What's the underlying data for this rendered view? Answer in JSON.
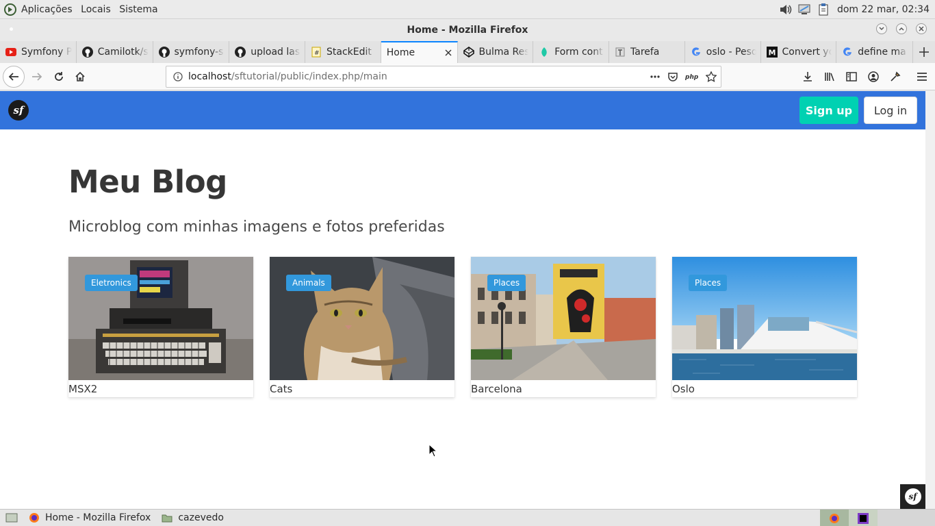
{
  "os_panel": {
    "menus": [
      "Aplicações",
      "Locais",
      "Sistema"
    ],
    "clock": "dom 22 mar, 02:34"
  },
  "window": {
    "title": "Home - Mozilla Firefox"
  },
  "tabs": [
    {
      "label": "Symfony P",
      "icon": "youtube-icon"
    },
    {
      "label": "Camilotk/s",
      "icon": "github-icon"
    },
    {
      "label": "symfony-s",
      "icon": "github-icon"
    },
    {
      "label": "upload las",
      "icon": "github-icon"
    },
    {
      "label": "StackEdit",
      "icon": "stackedit-icon"
    },
    {
      "label": "Home",
      "icon": "none",
      "active": true
    },
    {
      "label": "Bulma Res",
      "icon": "codepen-icon"
    },
    {
      "label": "Form cont",
      "icon": "leaf-icon"
    },
    {
      "label": "Tarefa",
      "icon": "tarefa-icon"
    },
    {
      "label": "oslo - Pesq",
      "icon": "google-icon"
    },
    {
      "label": "Convert yo",
      "icon": "medium-icon"
    },
    {
      "label": "define ma",
      "icon": "google-icon"
    }
  ],
  "urlbar": {
    "host": "localhost",
    "path": "/sftutorial/public/index.php/main"
  },
  "site": {
    "buttons": {
      "signup": "Sign up",
      "login": "Log in"
    },
    "title": "Meu Blog",
    "subtitle": "Microblog com minhas imagens e fotos preferidas",
    "cards": [
      {
        "tag": "Eletronics",
        "caption": "MSX2"
      },
      {
        "tag": "Animals",
        "caption": "Cats"
      },
      {
        "tag": "Places",
        "caption": "Barcelona"
      },
      {
        "tag": "Places",
        "caption": "Oslo"
      }
    ]
  },
  "taskbar": {
    "items": [
      "Home - Mozilla Firefox",
      "cazevedo"
    ]
  },
  "colors": {
    "brand": "#3273dc",
    "signup": "#00d1b2",
    "tag": "#3298dc",
    "tab_accent": "#0a84ff"
  }
}
